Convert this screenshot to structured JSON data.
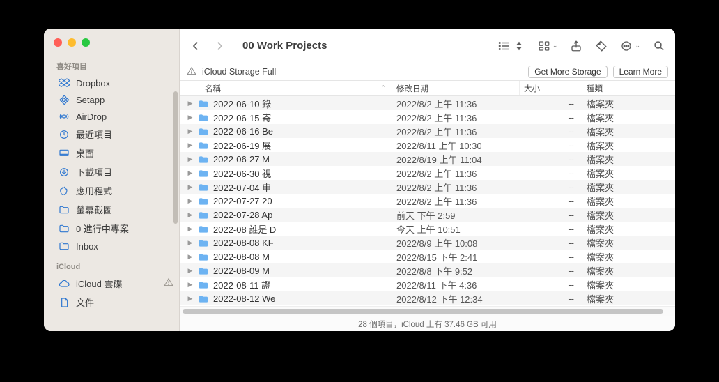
{
  "window": {
    "title": "00 Work Projects"
  },
  "sidebar": {
    "sections": [
      {
        "label": "喜好項目",
        "items": [
          {
            "icon": "dropbox",
            "label": "Dropbox"
          },
          {
            "icon": "setapp",
            "label": "Setapp"
          },
          {
            "icon": "airdrop",
            "label": "AirDrop"
          },
          {
            "icon": "clock",
            "label": "最近項目"
          },
          {
            "icon": "desktop",
            "label": "桌面"
          },
          {
            "icon": "download",
            "label": "下載項目"
          },
          {
            "icon": "apps",
            "label": "應用程式"
          },
          {
            "icon": "folder",
            "label": "螢幕截圖"
          },
          {
            "icon": "folder",
            "label": "0 進行中專案"
          },
          {
            "icon": "folder",
            "label": "Inbox"
          }
        ]
      },
      {
        "label": "iCloud",
        "items": [
          {
            "icon": "cloud",
            "label": "iCloud 雲碟",
            "warn": true
          },
          {
            "icon": "doc",
            "label": "文件"
          }
        ]
      }
    ]
  },
  "banner": {
    "message": "iCloud Storage Full",
    "btn1": "Get More Storage",
    "btn2": "Learn More"
  },
  "columns": {
    "name": "名稱",
    "date": "修改日期",
    "size": "大小",
    "kind": "種類"
  },
  "files": [
    {
      "name": "2022-06-10 錄",
      "date": "2022/8/2 上午 11:36",
      "size": "--",
      "kind": "檔案夾"
    },
    {
      "name": "2022-06-15 寄",
      "date": "2022/8/2 上午 11:36",
      "size": "--",
      "kind": "檔案夾"
    },
    {
      "name": "2022-06-16 Be",
      "date": "2022/8/2 上午 11:36",
      "size": "--",
      "kind": "檔案夾"
    },
    {
      "name": "2022-06-19 展",
      "date": "2022/8/11 上午 10:30",
      "size": "--",
      "kind": "檔案夾"
    },
    {
      "name": "2022-06-27 M",
      "date": "2022/8/19 上午 11:04",
      "size": "--",
      "kind": "檔案夾"
    },
    {
      "name": "2022-06-30 視",
      "date": "2022/8/2 上午 11:36",
      "size": "--",
      "kind": "檔案夾"
    },
    {
      "name": "2022-07-04 申",
      "date": "2022/8/2 上午 11:36",
      "size": "--",
      "kind": "檔案夾"
    },
    {
      "name": "2022-07-27 20",
      "date": "2022/8/2 上午 11:36",
      "size": "--",
      "kind": "檔案夾"
    },
    {
      "name": "2022-07-28 Ap",
      "date": "前天 下午 2:59",
      "size": "--",
      "kind": "檔案夾"
    },
    {
      "name": "2022-08 誰是 D",
      "date": "今天 上午 10:51",
      "size": "--",
      "kind": "檔案夾"
    },
    {
      "name": "2022-08-08 KF",
      "date": "2022/8/9 上午 10:08",
      "size": "--",
      "kind": "檔案夾"
    },
    {
      "name": "2022-08-08 M",
      "date": "2022/8/15 下午 2:41",
      "size": "--",
      "kind": "檔案夾"
    },
    {
      "name": "2022-08-09 M",
      "date": "2022/8/8 下午 9:52",
      "size": "--",
      "kind": "檔案夾"
    },
    {
      "name": "2022-08-11 證",
      "date": "2022/8/11 下午 4:36",
      "size": "--",
      "kind": "檔案夾"
    },
    {
      "name": "2022-08-12 We",
      "date": "2022/8/12 下午 12:34",
      "size": "--",
      "kind": "檔案夾"
    }
  ],
  "status": "28 個項目，iCloud 上有 37.46 GB 可用"
}
